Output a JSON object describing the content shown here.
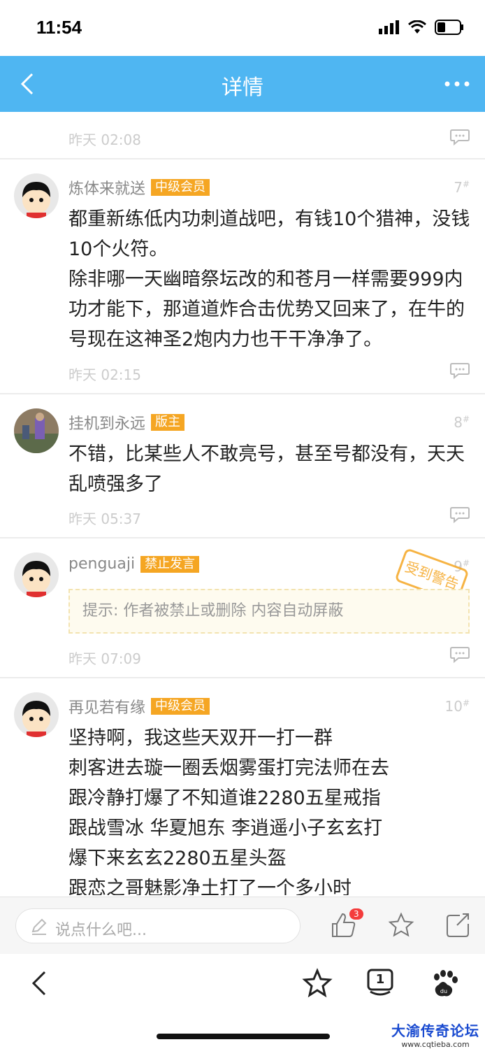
{
  "status": {
    "time": "11:54"
  },
  "nav": {
    "title": "详情"
  },
  "posts": [
    {
      "time": "昨天 02:08"
    },
    {
      "username": "炼体来就送",
      "badge": "中级会员",
      "floor": "7",
      "content": "都重新练低内功刺道战吧，有钱10个猎神，没钱10个火符。\n除非哪一天幽暗祭坛改的和苍月一样需要999内功才能下，那道道炸合击优势又回来了，在牛的号现在这神圣2炮内力也干干净净了。",
      "time": "昨天 02:15"
    },
    {
      "username": "挂机到永远",
      "badge": "版主",
      "floor": "8",
      "content": "不错，比某些人不敢亮号，甚至号都没有，天天乱喷强多了",
      "time": "昨天 05:37"
    },
    {
      "username": "penguaji",
      "badge": "禁止发言",
      "floor": "9",
      "stamp": "受到警告",
      "notice": "提示: 作者被禁止或删除 内容自动屏蔽",
      "time": "昨天 07:09"
    },
    {
      "username": "再见若有缘",
      "badge": "中级会员",
      "floor": "10",
      "content": "坚持啊，我这些天双开一打一群\n刺客进去璇一圈丢烟雾蛋打完法师在去\n跟冷静打爆了不知道谁2280五星戒指\n跟战雪冰 华夏旭东 李逍遥小子玄玄打\n爆下来玄玄2280五星头盔\n跟恋之哥魅影净土打了一个多小时"
    }
  ],
  "reply_bar": {
    "placeholder": "说点什么吧...",
    "like_count": "3"
  },
  "browser": {
    "tabs_count": "1"
  },
  "watermark": {
    "title": "大渝传奇论坛",
    "url": "www.cqtieba.com"
  },
  "colors": {
    "nav": "#4fb6f2",
    "badge": "#f5a623"
  }
}
